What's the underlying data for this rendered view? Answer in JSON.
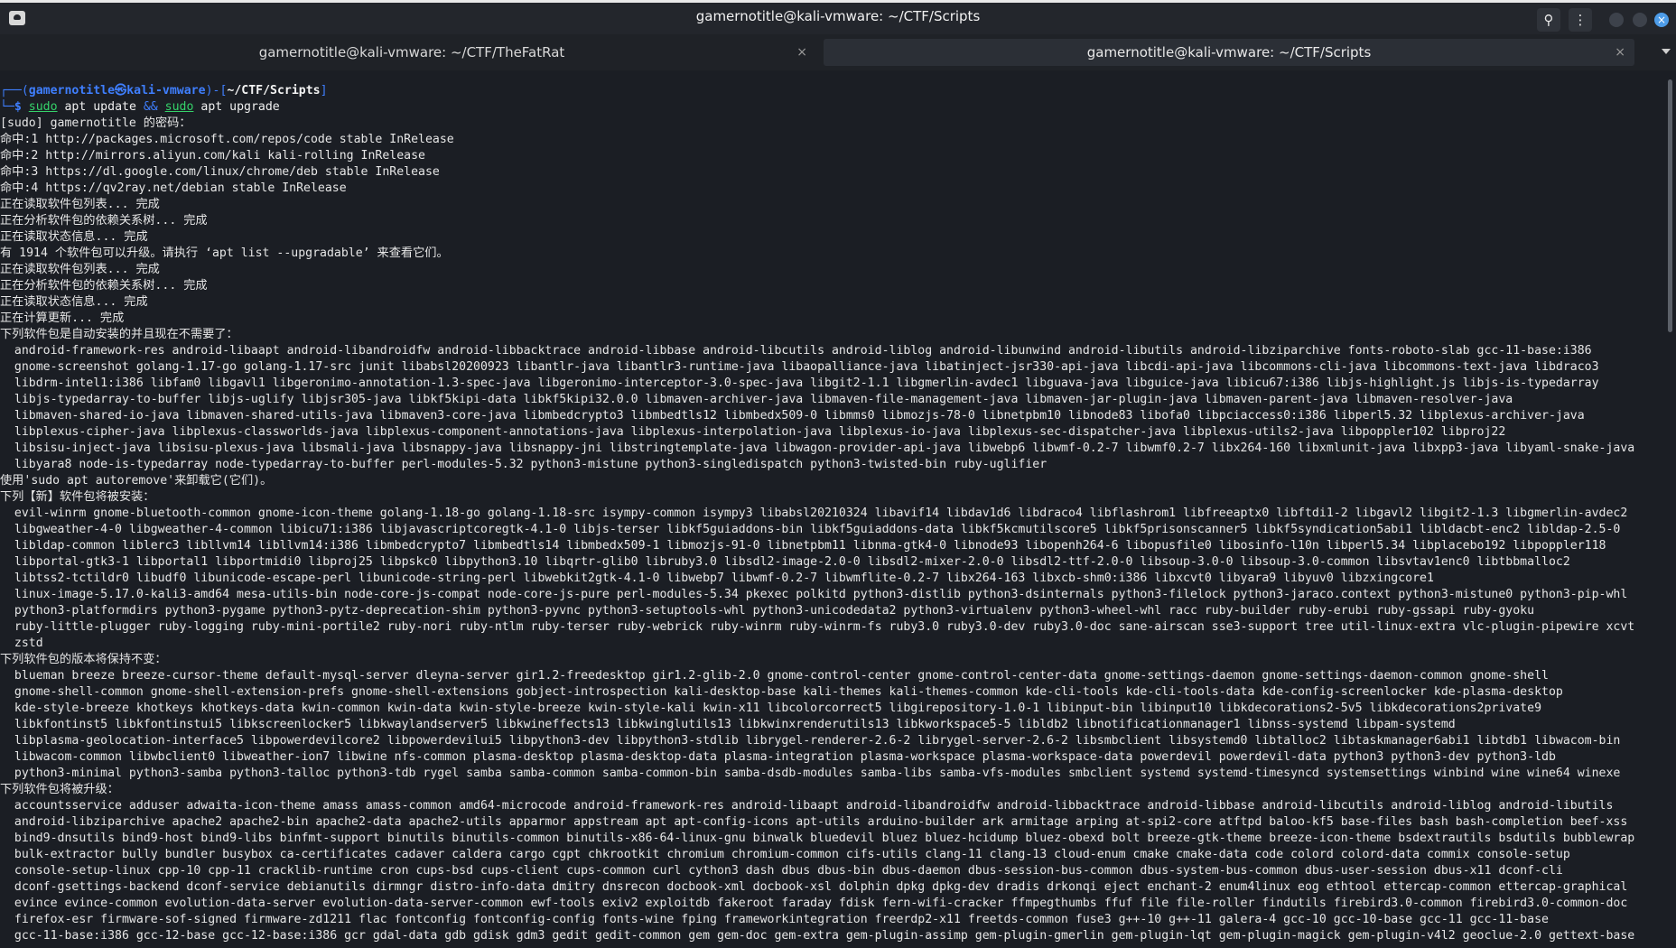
{
  "window": {
    "title": "gamernotitle@kali-vmware: ~/CTF/Scripts",
    "search_icon": "search-icon",
    "menu_icon": "kebab-menu-icon"
  },
  "tabs": [
    {
      "label": "gamernotitle@kali-vmware: ~/CTF/TheFatRat",
      "close": "×"
    },
    {
      "label": "gamernotitle@kali-vmware: ~/CTF/Scripts",
      "close": "×"
    }
  ],
  "prompt": {
    "line1_prefix": "┌──(",
    "user": "gamernotitle㉿kali-vmware",
    "mid": ")-[",
    "path": "~/CTF/Scripts",
    "end": "]",
    "line2_prefix": "└─",
    "dollar": "$ ",
    "sudo1": "sudo",
    "cmd1": " apt update ",
    "and": "&&",
    "sp": " ",
    "sudo2": "sudo",
    "cmd2": " apt upgrade"
  },
  "output_lines": [
    "[sudo] gamernotitle 的密码：",
    "命中:1 http://packages.microsoft.com/repos/code stable InRelease",
    "命中:2 http://mirrors.aliyun.com/kali kali-rolling InRelease",
    "命中:3 https://dl.google.com/linux/chrome/deb stable InRelease",
    "命中:4 https://qv2ray.net/debian stable InRelease",
    "正在读取软件包列表... 完成",
    "正在分析软件包的依赖关系树... 完成",
    "正在读取状态信息... 完成",
    "有 1914 个软件包可以升级。请执行 ‘apt list --upgradable’ 来查看它们。",
    "正在读取软件包列表... 完成",
    "正在分析软件包的依赖关系树... 完成",
    "正在读取状态信息... 完成",
    "正在计算更新... 完成",
    "下列软件包是自动安装的并且现在不需要了：",
    "  android-framework-res android-libaapt android-libandroidfw android-libbacktrace android-libbase android-libcutils android-liblog android-libunwind android-libutils android-libziparchive fonts-roboto-slab gcc-11-base:i386",
    "  gnome-screenshot golang-1.17-go golang-1.17-src junit libabsl20200923 libantlr-java libantlr3-runtime-java libaopalliance-java libatinject-jsr330-api-java libcdi-api-java libcommons-cli-java libcommons-text-java libdraco3",
    "  libdrm-intel1:i386 libfam0 libgavl1 libgeronimo-annotation-1.3-spec-java libgeronimo-interceptor-3.0-spec-java libgit2-1.1 libgmerlin-avdec1 libguava-java libguice-java libicu67:i386 libjs-highlight.js libjs-is-typedarray",
    "  libjs-typedarray-to-buffer libjs-uglify libjsr305-java libkf5kipi-data libkf5kipi32.0.0 libmaven-archiver-java libmaven-file-management-java libmaven-jar-plugin-java libmaven-parent-java libmaven-resolver-java",
    "  libmaven-shared-io-java libmaven-shared-utils-java libmaven3-core-java libmbedcrypto3 libmbedtls12 libmbedx509-0 libmms0 libmozjs-78-0 libnetpbm10 libnode83 libofa0 libpciaccess0:i386 libperl5.32 libplexus-archiver-java",
    "  libplexus-cipher-java libplexus-classworlds-java libplexus-component-annotations-java libplexus-interpolation-java libplexus-io-java libplexus-sec-dispatcher-java libplexus-utils2-java libpoppler102 libproj22",
    "  libsisu-inject-java libsisu-plexus-java libsmali-java libsnappy-java libsnappy-jni libstringtemplate-java libwagon-provider-api-java libwebp6 libwmf-0.2-7 libwmf0.2-7 libx264-160 libxmlunit-java libxpp3-java libyaml-snake-java",
    "  libyara8 node-is-typedarray node-typedarray-to-buffer perl-modules-5.32 python3-mistune python3-singledispatch python3-twisted-bin ruby-uglifier",
    "使用'sudo apt autoremove'来卸载它(它们)。",
    "下列【新】软件包将被安装：",
    "  evil-winrm gnome-bluetooth-common gnome-icon-theme golang-1.18-go golang-1.18-src isympy-common isympy3 libabsl20210324 libavif14 libdav1d6 libdraco4 libflashrom1 libfreeaptx0 libftdi1-2 libgavl2 libgit2-1.3 libgmerlin-avdec2",
    "  libgweather-4-0 libgweather-4-common libicu71:i386 libjavascriptcoregtk-4.1-0 libjs-terser libkf5guiaddons-bin libkf5guiaddons-data libkf5kcmutilscore5 libkf5prisonscanner5 libkf5syndication5abi1 libldacbt-enc2 libldap-2.5-0",
    "  libldap-common liblerc3 libllvm14 libllvm14:i386 libmbedcrypto7 libmbedtls14 libmbedx509-1 libmozjs-91-0 libnetpbm11 libnma-gtk4-0 libnode93 libopenh264-6 libopusfile0 libosinfo-l10n libperl5.34 libplacebo192 libpoppler118",
    "  libportal-gtk3-1 libportal1 libportmidi0 libproj25 libpskc0 libpython3.10 libqrtr-glib0 libruby3.0 libsdl2-image-2.0-0 libsdl2-mixer-2.0-0 libsdl2-ttf-2.0-0 libsoup-3.0-0 libsoup-3.0-common libsvtav1enc0 libtbbmalloc2",
    "  libtss2-tctildr0 libudf0 libunicode-escape-perl libunicode-string-perl libwebkit2gtk-4.1-0 libwebp7 libwmf-0.2-7 libwmflite-0.2-7 libx264-163 libxcb-shm0:i386 libxcvt0 libyara9 libyuv0 libzxingcore1",
    "  linux-image-5.17.0-kali3-amd64 mesa-utils-bin node-core-js-compat node-core-js-pure perl-modules-5.34 pkexec polkitd python3-distlib python3-dsinternals python3-filelock python3-jaraco.context python3-mistune0 python3-pip-whl",
    "  python3-platformdirs python3-pygame python3-pytz-deprecation-shim python3-pyvnc python3-setuptools-whl python3-unicodedata2 python3-virtualenv python3-wheel-whl racc ruby-builder ruby-erubi ruby-gssapi ruby-gyoku",
    "  ruby-little-plugger ruby-logging ruby-mini-portile2 ruby-nori ruby-ntlm ruby-terser ruby-webrick ruby-winrm ruby-winrm-fs ruby3.0 ruby3.0-dev ruby3.0-doc sane-airscan sse3-support tree util-linux-extra vlc-plugin-pipewire xcvt",
    "  zstd",
    "下列软件包的版本将保持不变：",
    "  blueman breeze breeze-cursor-theme default-mysql-server dleyna-server gir1.2-freedesktop gir1.2-glib-2.0 gnome-control-center gnome-control-center-data gnome-settings-daemon gnome-settings-daemon-common gnome-shell",
    "  gnome-shell-common gnome-shell-extension-prefs gnome-shell-extensions gobject-introspection kali-desktop-base kali-themes kali-themes-common kde-cli-tools kde-cli-tools-data kde-config-screenlocker kde-plasma-desktop",
    "  kde-style-breeze khotkeys khotkeys-data kwin-common kwin-data kwin-style-breeze kwin-style-kali kwin-x11 libcolorcorrect5 libgirepository-1.0-1 libinput-bin libinput10 libkdecorations2-5v5 libkdecorations2private9",
    "  libkfontinst5 libkfontinstui5 libkscreenlocker5 libkwaylandserver5 libkwineffects13 libkwinglutils13 libkwinxrenderutils13 libkworkspace5-5 libldb2 libnotificationmanager1 libnss-systemd libpam-systemd",
    "  libplasma-geolocation-interface5 libpowerdevilcore2 libpowerdevilui5 libpython3-dev libpython3-stdlib librygel-renderer-2.6-2 librygel-server-2.6-2 libsmbclient libsystemd0 libtalloc2 libtaskmanager6abi1 libtdb1 libwacom-bin",
    "  libwacom-common libwbclient0 libweather-ion7 libwine nfs-common plasma-desktop plasma-desktop-data plasma-integration plasma-workspace plasma-workspace-data powerdevil powerdevil-data python3 python3-dev python3-ldb",
    "  python3-minimal python3-samba python3-talloc python3-tdb rygel samba samba-common samba-common-bin samba-dsdb-modules samba-libs samba-vfs-modules smbclient systemd systemd-timesyncd systemsettings winbind wine wine64 winexe",
    "下列软件包将被升级：",
    "  accountsservice adduser adwaita-icon-theme amass amass-common amd64-microcode android-framework-res android-libaapt android-libandroidfw android-libbacktrace android-libbase android-libcutils android-liblog android-libutils",
    "  android-libziparchive apache2 apache2-bin apache2-data apache2-utils apparmor appstream apt apt-config-icons apt-utils arduino-builder ark armitage arping at-spi2-core atftpd baloo-kf5 base-files bash bash-completion beef-xss",
    "  bind9-dnsutils bind9-host bind9-libs binfmt-support binutils binutils-common binutils-x86-64-linux-gnu binwalk bluedevil bluez bluez-hcidump bluez-obexd bolt breeze-gtk-theme breeze-icon-theme bsdextrautils bsdutils bubblewrap",
    "  bulk-extractor bully bundler busybox ca-certificates cadaver caldera cargo cgpt chkrootkit chromium chromium-common cifs-utils clang-11 clang-13 cloud-enum cmake cmake-data code colord colord-data commix console-setup",
    "  console-setup-linux cpp-10 cpp-11 cracklib-runtime cron cups-bsd cups-client cups-common curl cython3 dash dbus dbus-bin dbus-daemon dbus-session-bus-common dbus-system-bus-common dbus-user-session dbus-x11 dconf-cli",
    "  dconf-gsettings-backend dconf-service debianutils dirmngr distro-info-data dmitry dnsrecon docbook-xml docbook-xsl dolphin dpkg dpkg-dev dradis drkonqi eject enchant-2 enum4linux eog ethtool ettercap-common ettercap-graphical",
    "  evince evince-common evolution-data-server evolution-data-server-common ewf-tools exiv2 exploitdb fakeroot faraday fdisk fern-wifi-cracker ffmpegthumbs ffuf file file-roller findutils firebird3.0-common firebird3.0-common-doc",
    "  firefox-esr firmware-sof-signed firmware-zd1211 flac fontconfig fontconfig-config fonts-wine fping frameworkintegration freerdp2-x11 freetds-common fuse3 g++-10 g++-11 galera-4 gcc-10 gcc-10-base gcc-11 gcc-11-base",
    "  gcc-11-base:i386 gcc-12-base gcc-12-base:i386 gcr gdal-data gdb gdisk gdm3 gedit gedit-common gem gem-doc gem-extra gem-plugin-assimp gem-plugin-gmerlin gem-plugin-lqt gem-plugin-magick gem-plugin-v4l2 geoclue-2.0 gettext-base"
  ]
}
